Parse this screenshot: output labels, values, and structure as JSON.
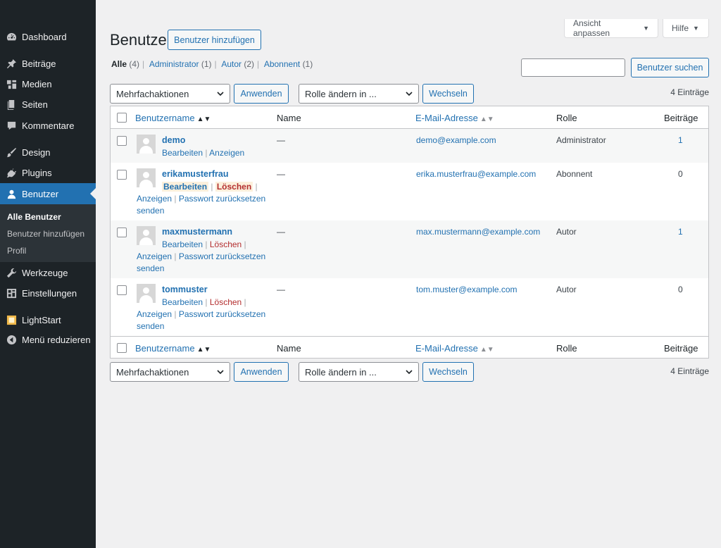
{
  "sidebar": {
    "items": [
      {
        "label": "Dashboard",
        "icon": "dashboard-icon"
      },
      {
        "label": "Beiträge",
        "icon": "pin-icon"
      },
      {
        "label": "Medien",
        "icon": "media-icon"
      },
      {
        "label": "Seiten",
        "icon": "pages-icon"
      },
      {
        "label": "Kommentare",
        "icon": "comment-icon"
      },
      {
        "label": "Design",
        "icon": "brush-icon"
      },
      {
        "label": "Plugins",
        "icon": "plug-icon"
      },
      {
        "label": "Benutzer",
        "icon": "user-icon"
      },
      {
        "label": "Werkzeuge",
        "icon": "wrench-icon"
      },
      {
        "label": "Einstellungen",
        "icon": "settings-icon"
      },
      {
        "label": "LightStart",
        "icon": "lightstart-icon"
      },
      {
        "label": "Menü reduzieren",
        "icon": "collapse-icon"
      }
    ],
    "submenu": [
      "Alle Benutzer",
      "Benutzer hinzufügen",
      "Profil"
    ]
  },
  "screen_options": {
    "label": "Ansicht anpassen",
    "help": "Hilfe"
  },
  "header": {
    "title": "Benutzer",
    "add_button": "Benutzer hinzufügen"
  },
  "filters": [
    {
      "label": "Alle",
      "count": "(4)"
    },
    {
      "label": "Administrator",
      "count": "(1)"
    },
    {
      "label": "Autor",
      "count": "(2)"
    },
    {
      "label": "Abonnent",
      "count": "(1)"
    }
  ],
  "search": {
    "button": "Benutzer suchen",
    "value": ""
  },
  "bulk": {
    "action_select": "Mehrfachaktionen",
    "apply": "Anwenden",
    "role_select": "Rolle ändern in ...",
    "change": "Wechseln",
    "count": "4 Einträge"
  },
  "table": {
    "columns": {
      "username": "Benutzername",
      "name": "Name",
      "email": "E-Mail-Adresse",
      "role": "Rolle",
      "posts": "Beiträge"
    },
    "actions": {
      "edit": "Bearbeiten",
      "view": "Anzeigen",
      "delete": "Löschen",
      "reset": "Passwort zurücksetzen",
      "send": "senden"
    },
    "rows": [
      {
        "username": "demo",
        "name": "—",
        "email": "demo@example.com",
        "role": "Administrator",
        "posts": "1"
      },
      {
        "username": "erikamusterfrau",
        "name": "—",
        "email": "erika.musterfrau@example.com",
        "role": "Abonnent",
        "posts": "0"
      },
      {
        "username": "maxmustermann",
        "name": "—",
        "email": "max.mustermann@example.com",
        "role": "Autor",
        "posts": "1"
      },
      {
        "username": "tommuster",
        "name": "—",
        "email": "tom.muster@example.com",
        "role": "Autor",
        "posts": "0"
      }
    ]
  },
  "colors": {
    "accent": "#2271b1",
    "sidebar_bg": "#1d2327",
    "delete": "#b32d2e"
  }
}
